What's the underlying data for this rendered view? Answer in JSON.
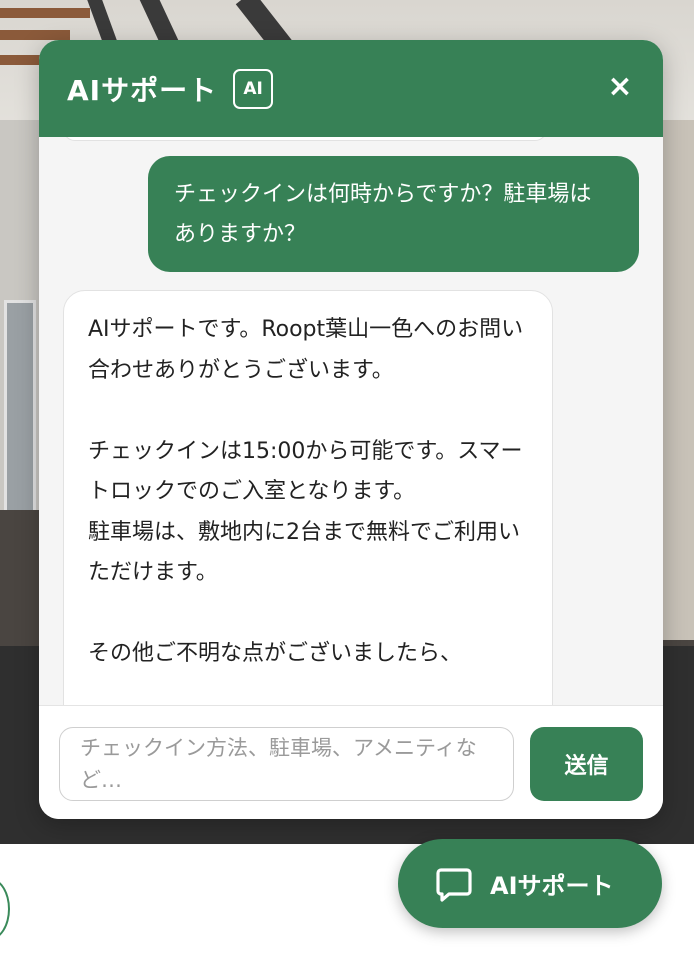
{
  "colors": {
    "accent": "#378156",
    "header_text": "#ffffff",
    "panel_bg": "#f5f5f5",
    "backdrop_dark": "#2f2f2f"
  },
  "chat": {
    "title": "AIサポート",
    "badge": "AI",
    "close_icon": "close-icon",
    "close_glyph": "×",
    "messages": [
      {
        "role": "user",
        "text": "チェックインは何時からですか？駐車場はありますか？"
      },
      {
        "role": "assistant",
        "text": "AIサポートです。Roopt葉山一色へのお問い合わせありがとうございます。\n\nチェックインは15:00から可能です。スマートロックでのご入室となります。\n駐車場は、敷地内に2台まで無料でご利用いただけます。\n\nその他ご不明な点がございましたら、"
      }
    ],
    "input_placeholder": "チェックイン方法、駐車場、アメニティなど…",
    "send_label": "送信"
  },
  "launcher": {
    "icon": "chat-bubble-icon",
    "label": "AIサポート"
  }
}
